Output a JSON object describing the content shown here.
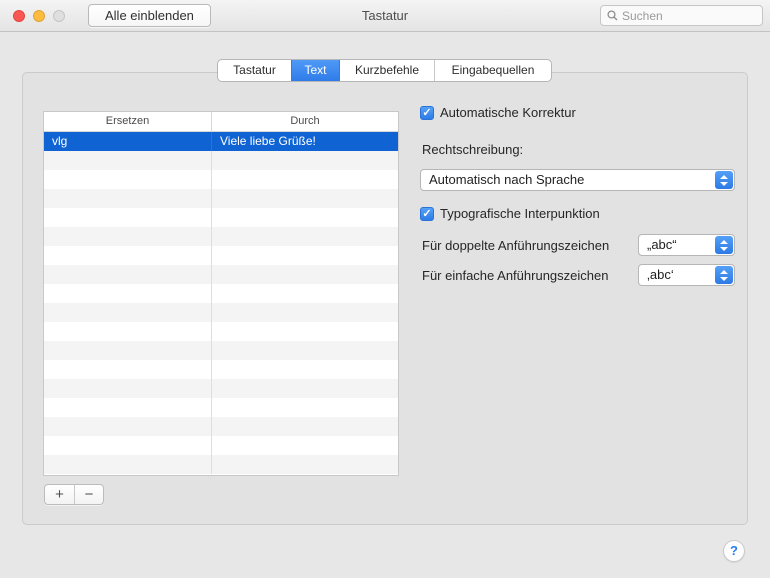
{
  "window": {
    "title": "Tastatur"
  },
  "toolbar": {
    "show_all_label": "Alle einblenden",
    "search_placeholder": "Suchen"
  },
  "tabs": [
    {
      "label": "Tastatur",
      "selected": false
    },
    {
      "label": "Text",
      "selected": true
    },
    {
      "label": "Kurzbefehle",
      "selected": false
    },
    {
      "label": "Eingabequellen",
      "selected": false
    }
  ],
  "table": {
    "columns": [
      "Ersetzen",
      "Durch"
    ],
    "rows": [
      {
        "ersetzen": "vlg",
        "durch": "Viele liebe Grüße!",
        "selected": true
      }
    ],
    "empty_row_count": 17
  },
  "table_buttons": {
    "add": "+",
    "remove": "−"
  },
  "options": {
    "autocorrect": {
      "label": "Automatische Korrektur",
      "checked": true,
      "check_glyph": "✓"
    },
    "spelling": {
      "label": "Rechtschreibung:",
      "value": "Automatisch nach Sprache"
    },
    "typographic": {
      "label": "Typografische Interpunktion",
      "checked": true,
      "check_glyph": "✓"
    },
    "double_quotes": {
      "label": "Für doppelte Anführungszeichen",
      "value": "„abc“"
    },
    "single_quotes": {
      "label": "Für einfache Anführungszeichen",
      "value": "‚abc‘"
    }
  },
  "help_label": "?",
  "colors": {
    "accent_blue": "#3b8bf4",
    "selection_blue": "#1063d2",
    "stripe_gray": "#f4f4f4"
  }
}
